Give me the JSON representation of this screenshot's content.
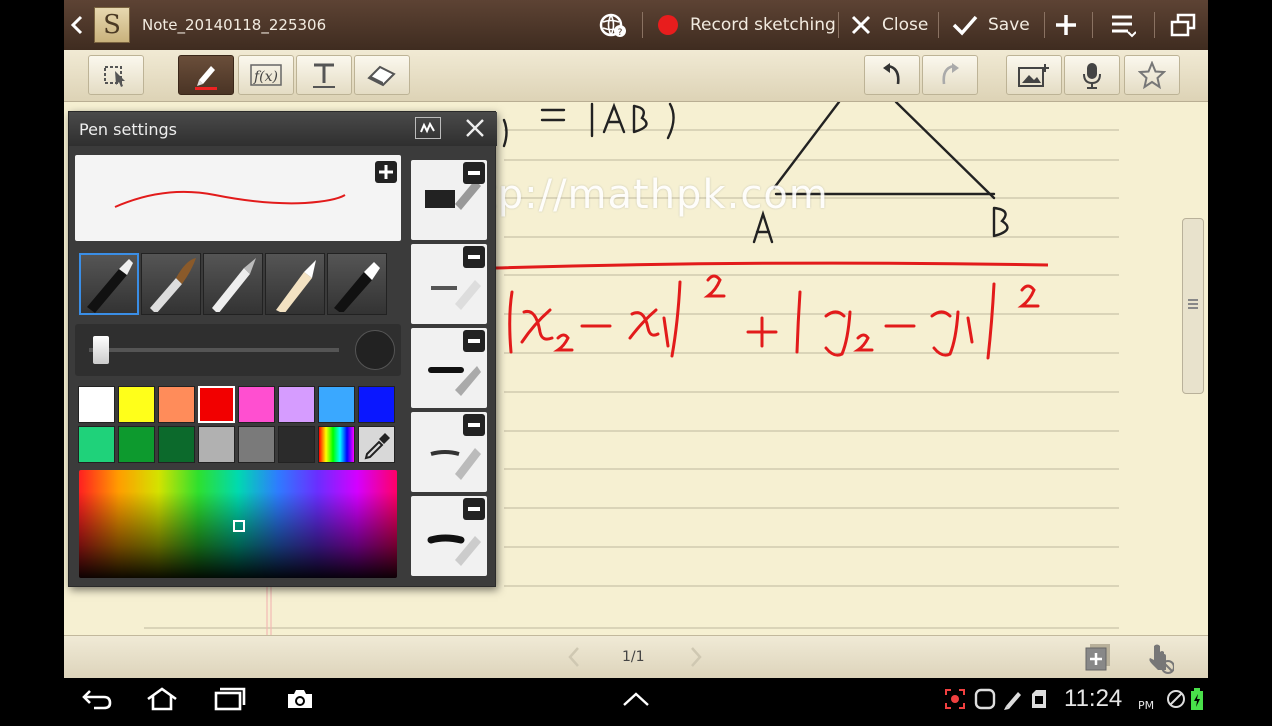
{
  "topbar": {
    "note_title": "Note_20140118_225306",
    "record_label": "Record sketching",
    "close_label": "Close",
    "save_label": "Save"
  },
  "pen_panel": {
    "title": "Pen settings"
  },
  "canvas": {
    "watermark": "http://mathpk.com",
    "label_a": "A",
    "label_b": "B"
  },
  "pagebar": {
    "page_indicator": "1/1"
  },
  "status": {
    "time": "11:24",
    "ampm": "PM"
  },
  "colors": {
    "swatches": [
      "#ffffff",
      "#ffff1a",
      "#ff8c5a",
      "#f20000",
      "#ff4fd0",
      "#d69cff",
      "#3aa8ff",
      "#0a17ff",
      "#1fd27a",
      "#0d9a2e",
      "#0c6a2c",
      "#b1b1b1",
      "#7a7a7a",
      "#2b2b2b",
      "rainbow",
      "eyedropper"
    ],
    "selected": "#f20000",
    "ink_red": "#e21b1b"
  }
}
